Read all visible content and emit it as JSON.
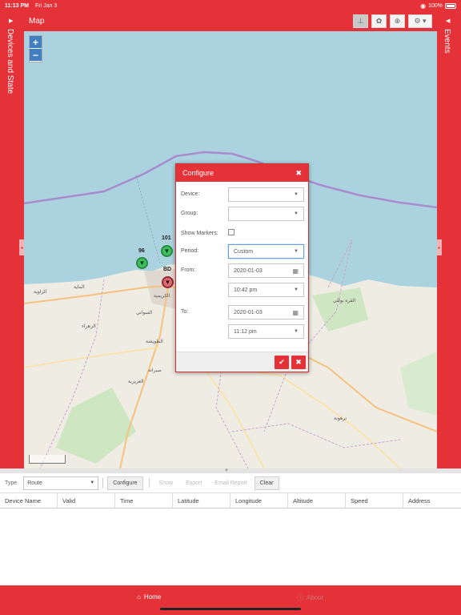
{
  "status_bar": {
    "time": "11:13 PM",
    "date": "Fri Jan 3",
    "battery": "100%"
  },
  "left_panel": {
    "title": "Devices and State"
  },
  "right_panel": {
    "title": "Events"
  },
  "map": {
    "title": "Map",
    "zoom_in": "+",
    "zoom_out": "−",
    "markers": [
      {
        "label": "96",
        "color": "green"
      },
      {
        "label": "101",
        "color": "green"
      },
      {
        "label": "BD",
        "color": "red"
      }
    ],
    "places": [
      "الزاوية",
      "الزهراء",
      "العزيزية",
      "ترهونة",
      "الكريمية",
      "السواني",
      "الطويشة",
      "القره بوللي",
      "الماية",
      "صبراتة"
    ]
  },
  "configure_dialog": {
    "title": "Configure",
    "device_label": "Device:",
    "device_value": "",
    "group_label": "Group:",
    "group_value": "",
    "show_markers_label": "Show Markers:",
    "period_label": "Period:",
    "period_value": "Custom",
    "from_label": "From:",
    "from_date": "2020-01-03",
    "from_time": "10:42 pm",
    "to_label": "To:",
    "to_date": "2020-01-03",
    "to_time": "11:12 pm"
  },
  "toolbar": {
    "type_label": "Type",
    "type_value": "Route",
    "configure": "Configure",
    "show": "Show",
    "export": "Export",
    "email_report": "Email Report",
    "clear": "Clear"
  },
  "table": {
    "columns": [
      "Device Name",
      "Valid",
      "Time",
      "Latitude",
      "Longitude",
      "Altitude",
      "Speed",
      "Address"
    ]
  },
  "tabbar": {
    "home": "Home",
    "about": "About"
  },
  "colors": {
    "brand": "#e43238",
    "sea": "#aad3df",
    "land": "#eeece3"
  }
}
